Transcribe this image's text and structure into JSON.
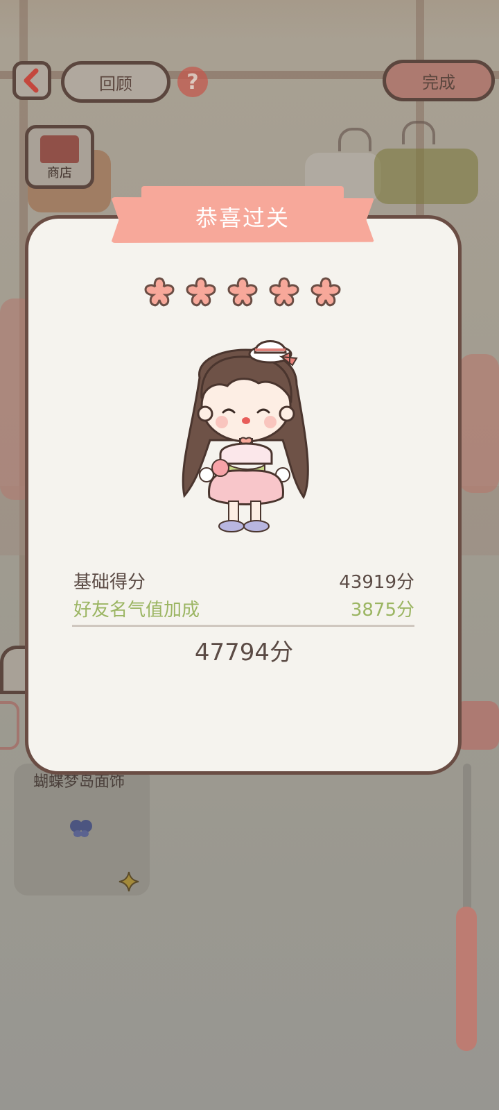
{
  "header": {
    "back_icon": "chevron-left-icon",
    "review_label": "回顾",
    "help_label": "?",
    "done_label": "完成"
  },
  "shop": {
    "label": "商店",
    "icon": "shop-icon"
  },
  "item_card": {
    "label": "蝴蝶梦岛面饰"
  },
  "dialog": {
    "title": "恭喜过关",
    "stars_earned": 5,
    "stars_total": 5,
    "base_label": "基础得分",
    "base_value": "43919分",
    "bonus_label": "好友名气值加成",
    "bonus_value": "3875分",
    "total_value": "47794分"
  },
  "colors": {
    "accent": "#f7a89a",
    "bonus_text": "#9bb562",
    "text": "#5b4b45",
    "border": "#6a4d44"
  }
}
